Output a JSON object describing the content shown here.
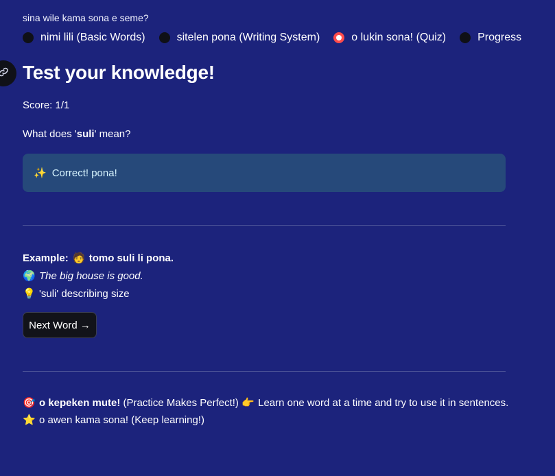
{
  "question_label": "sina wile kama sona e seme?",
  "nav": {
    "options": [
      {
        "label": "nimi lili (Basic Words)",
        "selected": false
      },
      {
        "label": "sitelen pona (Writing System)",
        "selected": false
      },
      {
        "label": "o lukin sona! (Quiz)",
        "selected": true
      },
      {
        "label": "Progress",
        "selected": false
      }
    ]
  },
  "quiz": {
    "title": "Test your knowledge!",
    "score": "Score: 1/1",
    "prompt_prefix": "What does '",
    "prompt_word": "suli",
    "prompt_suffix": "' mean?",
    "feedback_emoji": "✨",
    "feedback": "Correct! pona!"
  },
  "example": {
    "label": "Example:",
    "sentence_emoji": "🧑",
    "sentence": "tomo suli li pona.",
    "translation_emoji": "🌍",
    "translation": "The big house is good.",
    "note_emoji": "💡",
    "note": "'suli' describing size"
  },
  "next_button": "Next Word →",
  "footer": {
    "line1_emoji": "🎯",
    "line1_bold": "o kepeken mute!",
    "line1_text": "(Practice Makes Perfect!)",
    "line1_emoji2": "👉",
    "line1_text2": "Learn one word at a time and try to use it in sentences.",
    "line2_emoji": "⭐",
    "line2_text": "o awen kama sona! (Keep learning!)"
  },
  "colors": {
    "background": "#1c237c",
    "radio_selected": "#ff4b4b",
    "alert_bg": "#26497a",
    "divider": "#4a5196"
  }
}
